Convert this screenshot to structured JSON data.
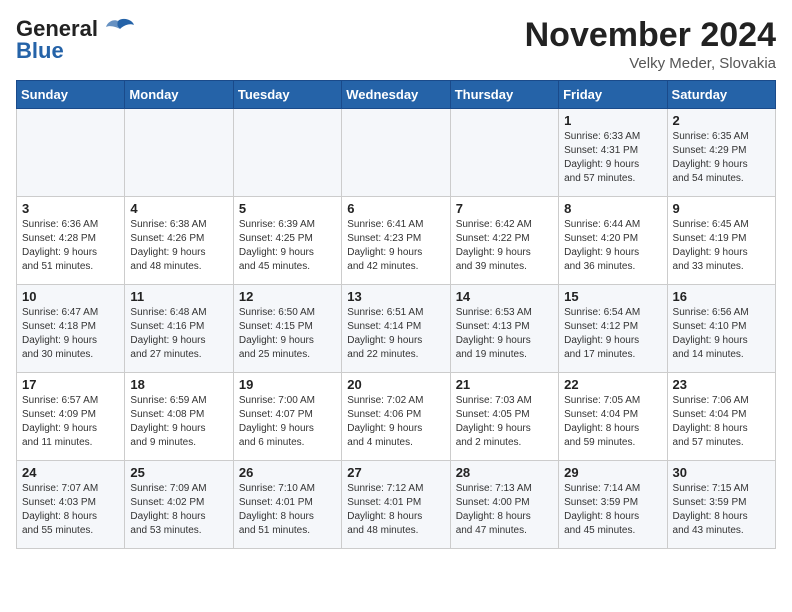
{
  "logo": {
    "line1": "General",
    "line2": "Blue"
  },
  "title": "November 2024",
  "location": "Velky Meder, Slovakia",
  "weekdays": [
    "Sunday",
    "Monday",
    "Tuesday",
    "Wednesday",
    "Thursday",
    "Friday",
    "Saturday"
  ],
  "weeks": [
    [
      {
        "day": "",
        "info": ""
      },
      {
        "day": "",
        "info": ""
      },
      {
        "day": "",
        "info": ""
      },
      {
        "day": "",
        "info": ""
      },
      {
        "day": "",
        "info": ""
      },
      {
        "day": "1",
        "info": "Sunrise: 6:33 AM\nSunset: 4:31 PM\nDaylight: 9 hours\nand 57 minutes."
      },
      {
        "day": "2",
        "info": "Sunrise: 6:35 AM\nSunset: 4:29 PM\nDaylight: 9 hours\nand 54 minutes."
      }
    ],
    [
      {
        "day": "3",
        "info": "Sunrise: 6:36 AM\nSunset: 4:28 PM\nDaylight: 9 hours\nand 51 minutes."
      },
      {
        "day": "4",
        "info": "Sunrise: 6:38 AM\nSunset: 4:26 PM\nDaylight: 9 hours\nand 48 minutes."
      },
      {
        "day": "5",
        "info": "Sunrise: 6:39 AM\nSunset: 4:25 PM\nDaylight: 9 hours\nand 45 minutes."
      },
      {
        "day": "6",
        "info": "Sunrise: 6:41 AM\nSunset: 4:23 PM\nDaylight: 9 hours\nand 42 minutes."
      },
      {
        "day": "7",
        "info": "Sunrise: 6:42 AM\nSunset: 4:22 PM\nDaylight: 9 hours\nand 39 minutes."
      },
      {
        "day": "8",
        "info": "Sunrise: 6:44 AM\nSunset: 4:20 PM\nDaylight: 9 hours\nand 36 minutes."
      },
      {
        "day": "9",
        "info": "Sunrise: 6:45 AM\nSunset: 4:19 PM\nDaylight: 9 hours\nand 33 minutes."
      }
    ],
    [
      {
        "day": "10",
        "info": "Sunrise: 6:47 AM\nSunset: 4:18 PM\nDaylight: 9 hours\nand 30 minutes."
      },
      {
        "day": "11",
        "info": "Sunrise: 6:48 AM\nSunset: 4:16 PM\nDaylight: 9 hours\nand 27 minutes."
      },
      {
        "day": "12",
        "info": "Sunrise: 6:50 AM\nSunset: 4:15 PM\nDaylight: 9 hours\nand 25 minutes."
      },
      {
        "day": "13",
        "info": "Sunrise: 6:51 AM\nSunset: 4:14 PM\nDaylight: 9 hours\nand 22 minutes."
      },
      {
        "day": "14",
        "info": "Sunrise: 6:53 AM\nSunset: 4:13 PM\nDaylight: 9 hours\nand 19 minutes."
      },
      {
        "day": "15",
        "info": "Sunrise: 6:54 AM\nSunset: 4:12 PM\nDaylight: 9 hours\nand 17 minutes."
      },
      {
        "day": "16",
        "info": "Sunrise: 6:56 AM\nSunset: 4:10 PM\nDaylight: 9 hours\nand 14 minutes."
      }
    ],
    [
      {
        "day": "17",
        "info": "Sunrise: 6:57 AM\nSunset: 4:09 PM\nDaylight: 9 hours\nand 11 minutes."
      },
      {
        "day": "18",
        "info": "Sunrise: 6:59 AM\nSunset: 4:08 PM\nDaylight: 9 hours\nand 9 minutes."
      },
      {
        "day": "19",
        "info": "Sunrise: 7:00 AM\nSunset: 4:07 PM\nDaylight: 9 hours\nand 6 minutes."
      },
      {
        "day": "20",
        "info": "Sunrise: 7:02 AM\nSunset: 4:06 PM\nDaylight: 9 hours\nand 4 minutes."
      },
      {
        "day": "21",
        "info": "Sunrise: 7:03 AM\nSunset: 4:05 PM\nDaylight: 9 hours\nand 2 minutes."
      },
      {
        "day": "22",
        "info": "Sunrise: 7:05 AM\nSunset: 4:04 PM\nDaylight: 8 hours\nand 59 minutes."
      },
      {
        "day": "23",
        "info": "Sunrise: 7:06 AM\nSunset: 4:04 PM\nDaylight: 8 hours\nand 57 minutes."
      }
    ],
    [
      {
        "day": "24",
        "info": "Sunrise: 7:07 AM\nSunset: 4:03 PM\nDaylight: 8 hours\nand 55 minutes."
      },
      {
        "day": "25",
        "info": "Sunrise: 7:09 AM\nSunset: 4:02 PM\nDaylight: 8 hours\nand 53 minutes."
      },
      {
        "day": "26",
        "info": "Sunrise: 7:10 AM\nSunset: 4:01 PM\nDaylight: 8 hours\nand 51 minutes."
      },
      {
        "day": "27",
        "info": "Sunrise: 7:12 AM\nSunset: 4:01 PM\nDaylight: 8 hours\nand 48 minutes."
      },
      {
        "day": "28",
        "info": "Sunrise: 7:13 AM\nSunset: 4:00 PM\nDaylight: 8 hours\nand 47 minutes."
      },
      {
        "day": "29",
        "info": "Sunrise: 7:14 AM\nSunset: 3:59 PM\nDaylight: 8 hours\nand 45 minutes."
      },
      {
        "day": "30",
        "info": "Sunrise: 7:15 AM\nSunset: 3:59 PM\nDaylight: 8 hours\nand 43 minutes."
      }
    ]
  ]
}
